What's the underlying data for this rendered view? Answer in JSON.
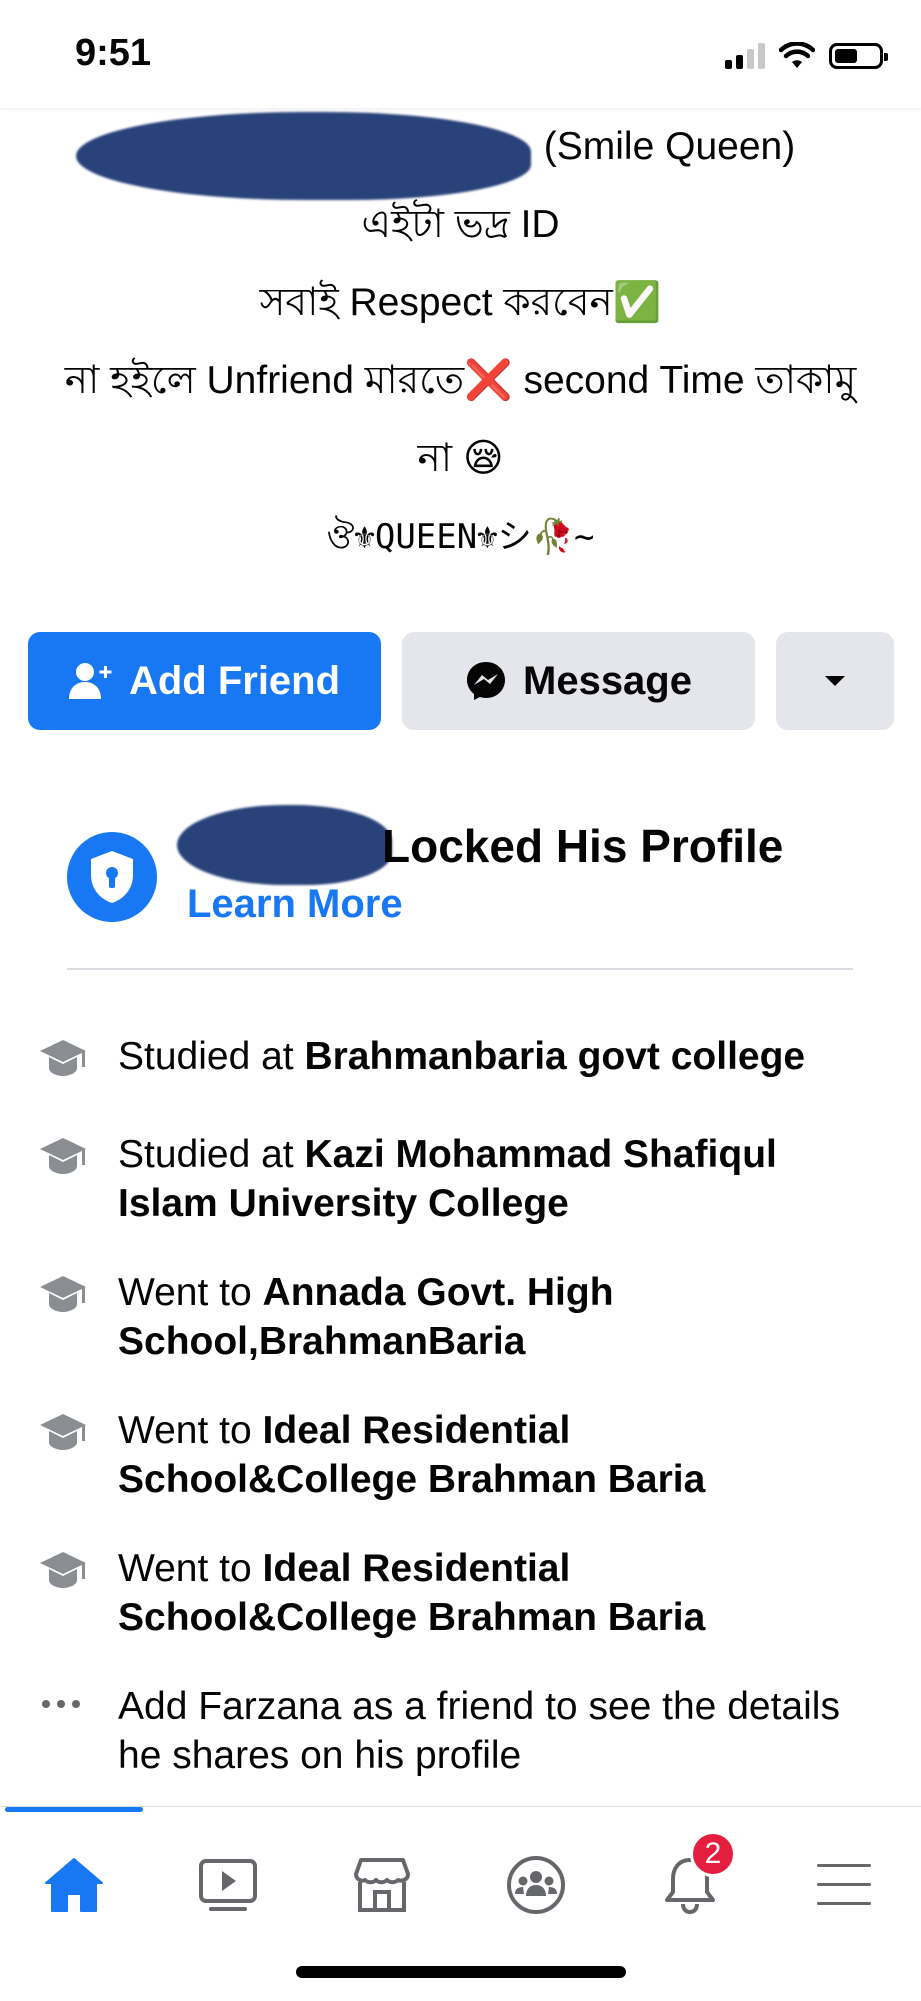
{
  "status_bar": {
    "time": "9:51"
  },
  "bio": {
    "name_suffix": "(Smile Queen)",
    "line2": "এইটা ভদ্র ID",
    "line3": "সবাই Respect করবেন✅",
    "line4": "না হইলে Unfriend মারতে❌ second Time তাকামু",
    "line5": "না 😪",
    "line6_queen": "ঔ⚜QUEEN⚜シ🥀~"
  },
  "actions": {
    "add_friend_label": "Add Friend",
    "message_label": "Message"
  },
  "locked": {
    "title": "Locked His Profile",
    "learn_more": "Learn More"
  },
  "intro": {
    "items": [
      {
        "prefix": "Studied at ",
        "place": "Brahmanbaria govt college",
        "icon": "graduation-cap-icon"
      },
      {
        "prefix": "Studied at ",
        "place": "Kazi Mohammad Shafiqul Islam University College",
        "icon": "graduation-cap-icon"
      },
      {
        "prefix": "Went to ",
        "place": "Annada Govt. High School,BrahmanBaria",
        "icon": "graduation-cap-icon"
      },
      {
        "prefix": "Went to ",
        "place": "Ideal Residential School&College Brahman Baria",
        "icon": "graduation-cap-icon"
      },
      {
        "prefix": "Went to ",
        "place": "Ideal Residential School&College Brahman Baria",
        "icon": "graduation-cap-icon"
      }
    ],
    "more_text": "Add Farzana as a friend to see the details he shares on his profile"
  },
  "tabbar": {
    "tabs": [
      "home-icon",
      "watch-icon",
      "marketplace-icon",
      "groups-icon",
      "notifications-icon",
      "menu-icon"
    ],
    "active": "home-icon",
    "notifications_badge": "2",
    "colors": {
      "active": "#1877f2",
      "inactive": "#65676b",
      "badge": "#e41e3f"
    }
  }
}
